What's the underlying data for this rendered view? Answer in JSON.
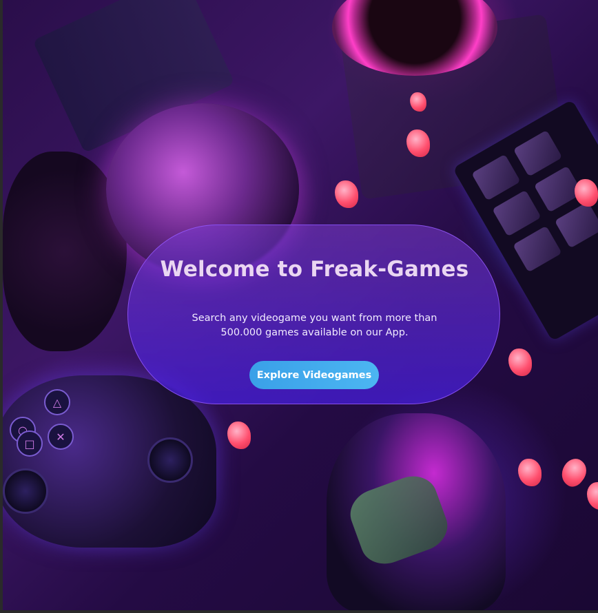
{
  "hero": {
    "title": "Welcome to Freak-Games",
    "description": "Search any videogame you want from more than 500.000 games available on our App.",
    "cta_label": "Explore Videogames"
  },
  "colors": {
    "accent": "#3aa0e8",
    "panel": "#5a2ad0",
    "background": "#2a0e4a"
  },
  "controller": {
    "buttons": [
      "△",
      "○",
      "□",
      "✕"
    ]
  }
}
